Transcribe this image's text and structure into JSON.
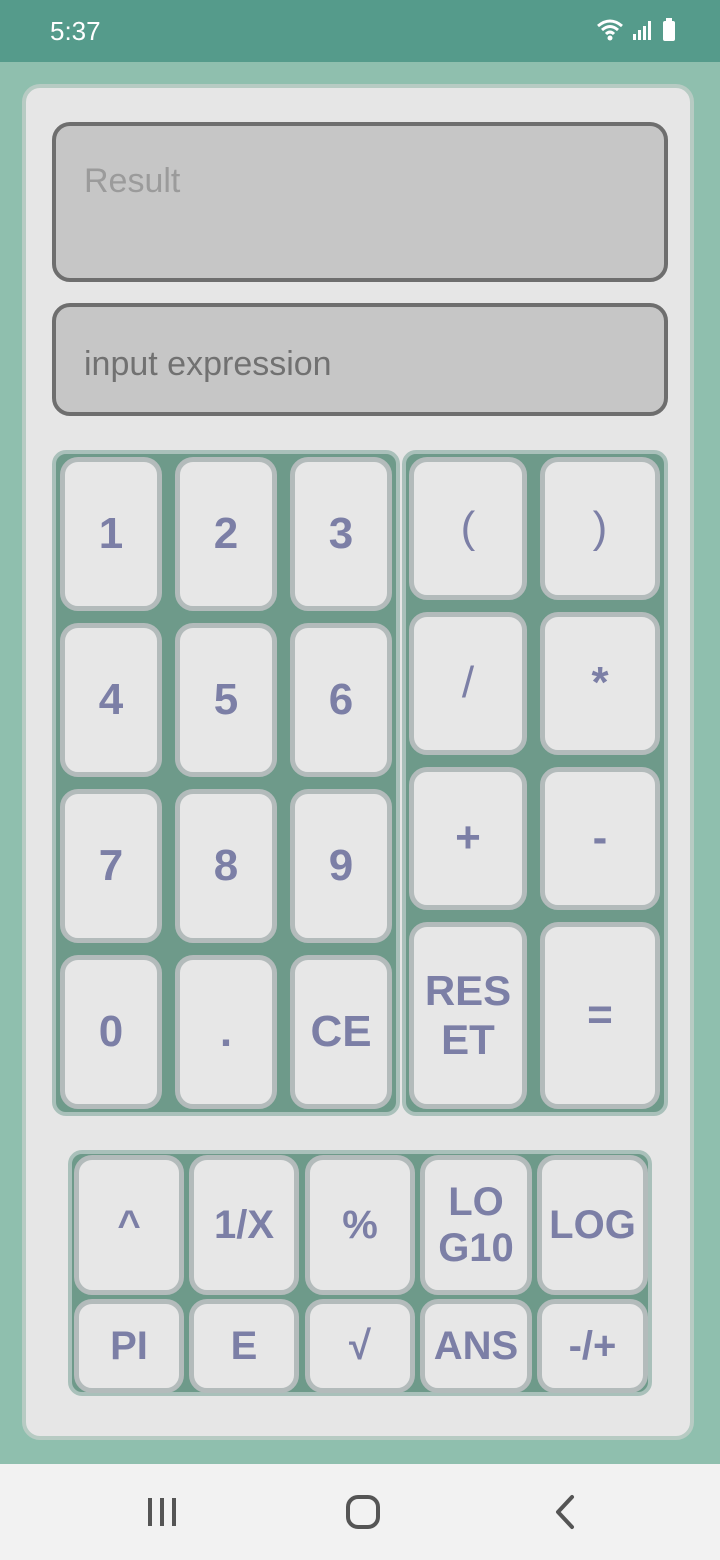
{
  "status_bar": {
    "time": "5:37",
    "icons": [
      "wifi-icon",
      "signal-icon",
      "battery-icon"
    ]
  },
  "display": {
    "result_placeholder": "Result",
    "input_placeholder": "input expression"
  },
  "keypad": {
    "digits": [
      "1",
      "2",
      "3",
      "4",
      "5",
      "6",
      "7",
      "8",
      "9",
      "0",
      ".",
      "CE"
    ],
    "operators": [
      "(",
      ")",
      "/",
      "*",
      "+",
      "-",
      "RESET",
      "="
    ],
    "scientific": [
      "^",
      "1/X",
      "%",
      "LOG10",
      "LOG",
      "PI",
      "E",
      "√",
      "ANS",
      "-/+"
    ]
  },
  "colors": {
    "status_bar": "#559b8b",
    "background": "#8fbfae",
    "key_text": "#7c7fa6",
    "pad": "#6e9a8a"
  },
  "nav_bar": {
    "icons": [
      "recents-icon",
      "home-icon",
      "back-icon"
    ]
  }
}
